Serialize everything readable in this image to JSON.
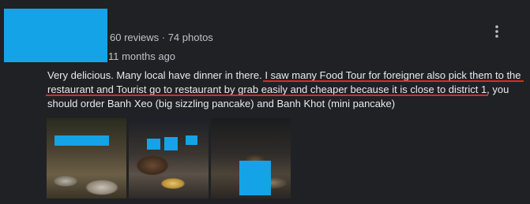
{
  "review": {
    "reviewer_meta": "60 reviews · 74 photos",
    "date": "11 months ago",
    "text_lines": [
      "Very delicious. Many local have dinner in there. I saw many Food Tour for foreigner also pick them to the",
      "restaurant and Tourist go to restaurant by grab easily and cheaper because it is close to district 1, you",
      "should order Banh Xeo (big sizzling pancake) and Banh Khot (mini pancake)"
    ],
    "highlight_color": "#e52620",
    "redaction_color": "#14a3e6"
  },
  "icons": {
    "more": "more-vertical-icon"
  }
}
